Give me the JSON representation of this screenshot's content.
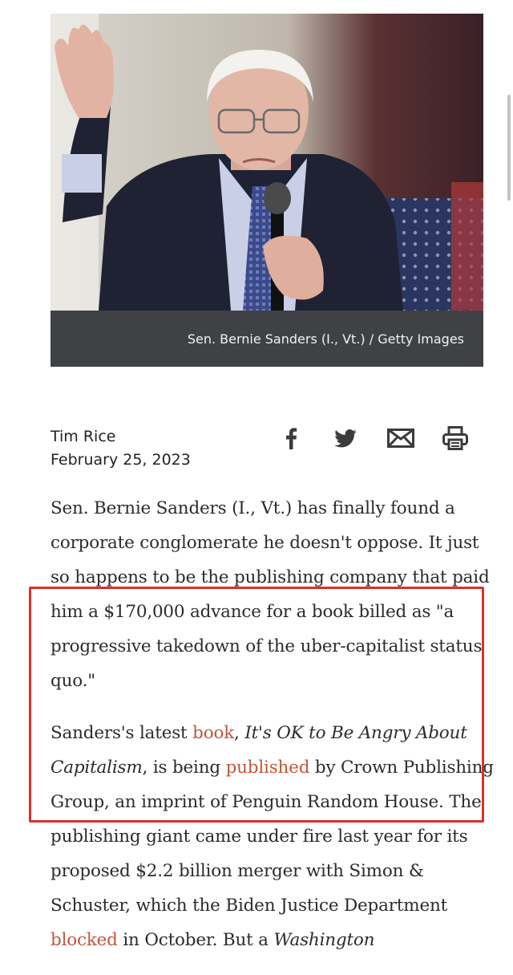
{
  "photo": {
    "alt": "Sen. Bernie Sanders speaking into a microphone",
    "caption": "Sen. Bernie Sanders (I., Vt.) / Getty Images"
  },
  "byline": {
    "author": "Tim Rice",
    "date": "February 25, 2023"
  },
  "share": [
    "facebook-icon",
    "twitter-icon",
    "email-icon",
    "print-icon"
  ],
  "article": {
    "p1": "Sen. Bernie Sanders (I., Vt.) has finally found a corporate conglomerate he doesn't oppose. It just so happens to be the publishing company that paid him a $170,000 advance for a book billed as \"a progressive takedown of the uber-capitalist status quo.\"",
    "p2_a": "Sanders's latest ",
    "p2_link_book": "book",
    "p2_b": ", ",
    "p2_title": "It's OK to Be Angry About Capitalism",
    "p2_c": ", is being ",
    "p2_link_published": "published",
    "p2_d": " by Crown Publishing Group, an imprint of Penguin Random House. The publishing giant came under fire last year for its proposed $2.2 billion merger with Simon & Schuster, which the Biden Justice Department ",
    "p2_link_blocked": "blocked",
    "p2_e": " in October. But a ",
    "p2_italic_end": "Washington"
  },
  "colors": {
    "link": "#c0563a",
    "highlight": "#d7322b",
    "caption_bg": "#3f4144"
  }
}
